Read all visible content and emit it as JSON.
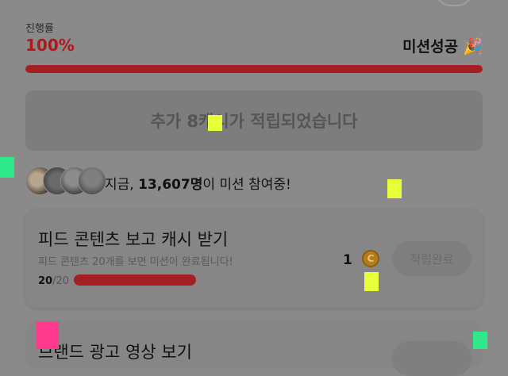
{
  "progress": {
    "label": "진행률",
    "value": "100%",
    "fraction": 1.0,
    "status": "미션성공",
    "status_icon": "party-popper-icon"
  },
  "notice": {
    "text": "추가 8캐시가 적립되었습니다"
  },
  "participants": {
    "prefix": "지금, ",
    "count": "13,607명",
    "suffix": "이 미션 참여중!"
  },
  "mission": {
    "title": "피드 콘텐츠 보고 캐시 받기",
    "description": "피드 콘텐츠 20개를 보면 미션이 완료됩니다!",
    "progress_current": "20",
    "progress_total": "/20",
    "progress_fraction": 1.0,
    "reward": "1",
    "reward_icon": "coin-icon",
    "coin_glyph": "C",
    "button_label": "적립완료"
  },
  "mission2": {
    "title": "브랜드 광고 영상 보기"
  },
  "colors": {
    "accent": "#a41f23",
    "percent": "#b2171c",
    "marker_green": "#2ee88a",
    "marker_yellow": "#e6ff3a",
    "marker_pink": "#ff3a8c"
  }
}
